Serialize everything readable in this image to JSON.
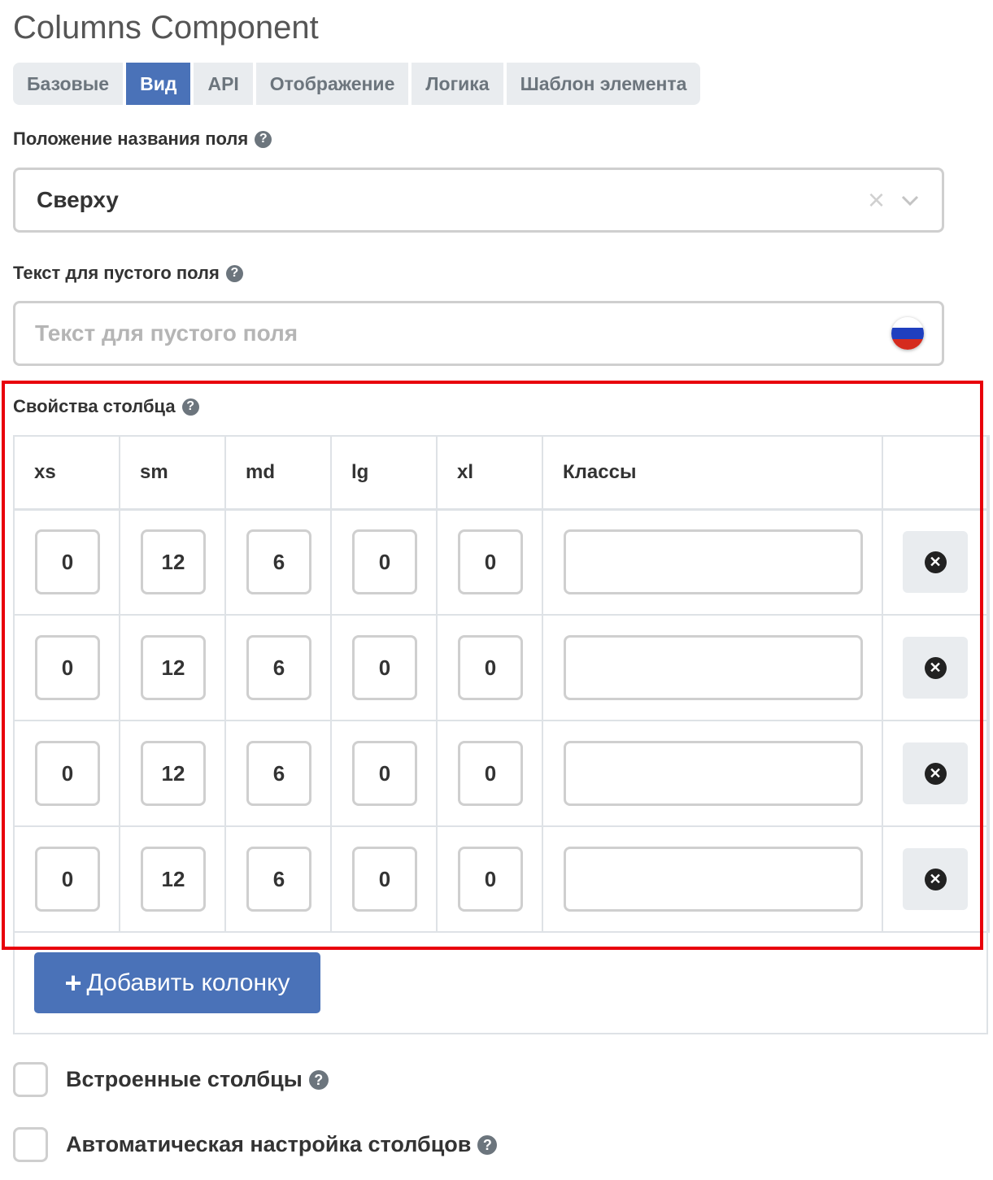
{
  "page": {
    "title": "Columns Component"
  },
  "tabs": [
    {
      "label": "Базовые",
      "active": false
    },
    {
      "label": "Вид",
      "active": true
    },
    {
      "label": "API",
      "active": false
    },
    {
      "label": "Отображение",
      "active": false
    },
    {
      "label": "Логика",
      "active": false
    },
    {
      "label": "Шаблон элемента",
      "active": false
    }
  ],
  "label_position": {
    "label": "Положение названия поля",
    "value": "Сверху",
    "clear_icon": "close-icon",
    "chevron_icon": "chevron-down-icon"
  },
  "placeholder_field": {
    "label": "Текст для пустого поля",
    "placeholder": "Текст для пустого поля",
    "flag_icon": "russia-flag-icon"
  },
  "columns_props": {
    "label": "Свойства столбца",
    "headers": [
      "xs",
      "sm",
      "md",
      "lg",
      "xl",
      "Классы"
    ],
    "rows": [
      {
        "xs": "0",
        "sm": "12",
        "md": "6",
        "lg": "0",
        "xl": "0",
        "classes": ""
      },
      {
        "xs": "0",
        "sm": "12",
        "md": "6",
        "lg": "0",
        "xl": "0",
        "classes": ""
      },
      {
        "xs": "0",
        "sm": "12",
        "md": "6",
        "lg": "0",
        "xl": "0",
        "classes": ""
      },
      {
        "xs": "0",
        "sm": "12",
        "md": "6",
        "lg": "0",
        "xl": "0",
        "classes": ""
      }
    ],
    "remove_icon": "times-circle-icon",
    "add_button": "Добавить колонку",
    "highlight_color": "#e8000b"
  },
  "checkboxes": [
    {
      "label": "Встроенные столбцы",
      "checked": false
    },
    {
      "label": "Автоматическая настройка столбцов",
      "checked": false
    }
  ],
  "help_icon": "question-circle-icon",
  "colors": {
    "primary": "#4a72b8",
    "tab_bg": "#e9ecef",
    "border": "#cfcfcf"
  }
}
